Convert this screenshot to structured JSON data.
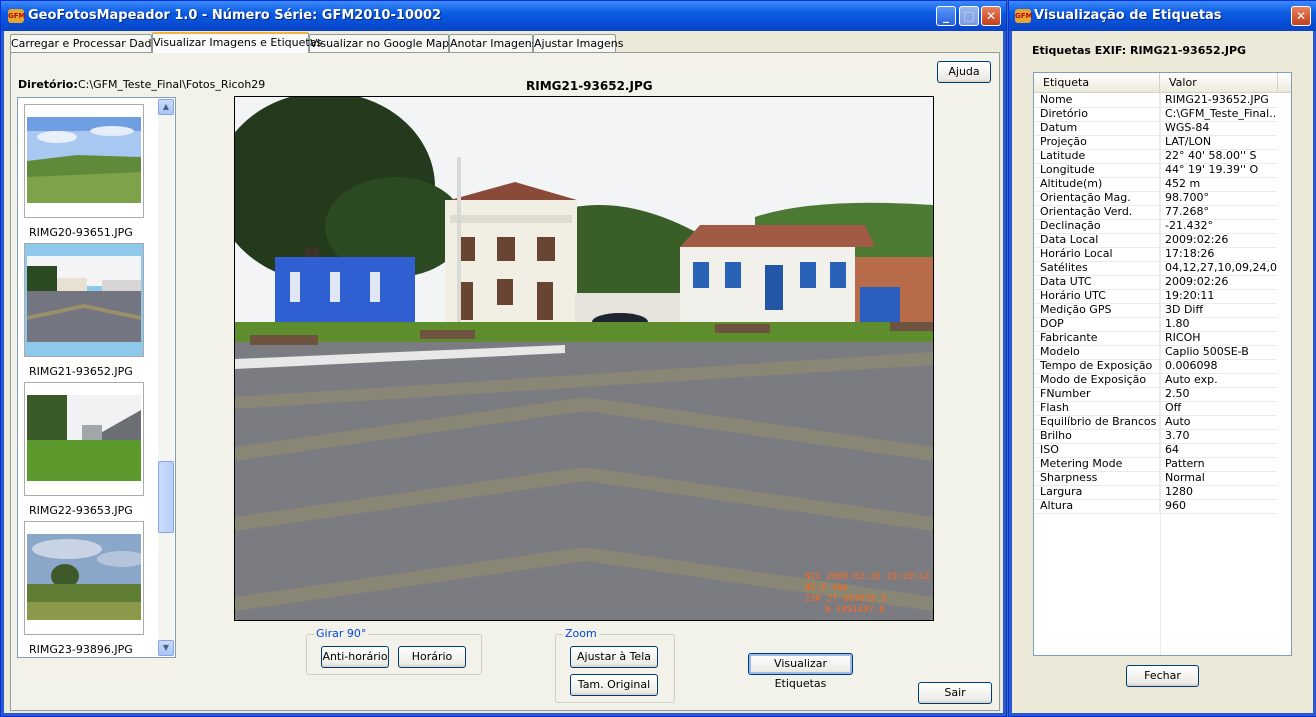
{
  "main_window": {
    "title": "GeoFotosMapeador 1.0 - Número Série: GFM2010-10002",
    "icon_text": "GFM",
    "tabs": [
      {
        "label": "Carregar e Processar Dados"
      },
      {
        "label": "Visualizar Imagens e Etiquetas"
      },
      {
        "label": "Visualizar no Google Maps"
      },
      {
        "label": "Anotar Imagens"
      },
      {
        "label": "Ajustar Imagens"
      }
    ],
    "active_tab": "Visualizar Imagens e Etiquetas",
    "help_button": "Ajuda",
    "directory_label": "Diretório:",
    "directory_value": "C:\\GFM_Teste_Final\\Fotos_Ricoh29",
    "image_title": "RIMG21-93652.JPG",
    "thumbnails": [
      {
        "caption": "RIMG20-93651.JPG",
        "selected": false
      },
      {
        "caption": "RIMG21-93652.JPG",
        "selected": true
      },
      {
        "caption": "RIMG22-93653.JPG",
        "selected": false
      },
      {
        "caption": "RIMG23-93896.JPG",
        "selected": false
      }
    ],
    "photo_overlay": [
      "NIC 2009:02:26 19:20:14",
      "N3:E 4mm",
      "23K 2T 663639.5",
      "N 2491497.0"
    ],
    "rotate_group": {
      "title": "Girar 90°",
      "ccw_button": "Anti-horário",
      "cw_button": "Horário"
    },
    "zoom_group": {
      "title": "Zoom",
      "fit_button": "Ajustar à Tela",
      "original_button": "Tam. Original"
    },
    "view_tags_button": "Visualizar Etiquetas",
    "exit_button": "Sair"
  },
  "tags_window": {
    "title": "Visualização de Etiquetas",
    "icon_text": "GFM",
    "heading": "Etiquetas EXIF: RIMG21-93652.JPG",
    "columns": {
      "key": "Etiqueta",
      "value": "Valor"
    },
    "rows": [
      {
        "k": "Nome",
        "v": "RIMG21-93652.JPG"
      },
      {
        "k": "Diretório",
        "v": "C:\\GFM_Teste_Final..."
      },
      {
        "k": "Datum",
        "v": "WGS-84"
      },
      {
        "k": "Projeção",
        "v": "LAT/LON"
      },
      {
        "k": "Latitude",
        "v": "22° 40' 58.00'' S"
      },
      {
        "k": "Longitude",
        "v": "44° 19' 19.39'' O"
      },
      {
        "k": "Altitude(m)",
        "v": "452 m"
      },
      {
        "k": "Orientação Mag.",
        "v": "98.700°"
      },
      {
        "k": "Orientação Verd.",
        "v": "77.268°"
      },
      {
        "k": "Declinação",
        "v": "-21.432°"
      },
      {
        "k": "Data Local",
        "v": "2009:02:26"
      },
      {
        "k": "Horário Local",
        "v": "17:18:26"
      },
      {
        "k": "Satélites",
        "v": "04,12,27,10,09,24,0..."
      },
      {
        "k": "Data UTC",
        "v": "2009:02:26"
      },
      {
        "k": "Horário UTC",
        "v": "19:20:11"
      },
      {
        "k": "Medição GPS",
        "v": "3D Diff"
      },
      {
        "k": "DOP",
        "v": "1.80"
      },
      {
        "k": "Fabricante",
        "v": "RICOH"
      },
      {
        "k": "Modelo",
        "v": "Caplio 500SE-B"
      },
      {
        "k": "Tempo de Exposição",
        "v": "0.006098"
      },
      {
        "k": "Modo de Exposição",
        "v": "Auto exp."
      },
      {
        "k": "FNumber",
        "v": "2.50"
      },
      {
        "k": "Flash",
        "v": "Off"
      },
      {
        "k": "Equilíbrio de Brancos",
        "v": "Auto"
      },
      {
        "k": "Brilho",
        "v": "3.70"
      },
      {
        "k": "ISO",
        "v": "64"
      },
      {
        "k": "Metering Mode",
        "v": "Pattern"
      },
      {
        "k": "Sharpness",
        "v": "Normal"
      },
      {
        "k": "Largura",
        "v": "1280"
      },
      {
        "k": "Altura",
        "v": "960"
      }
    ],
    "close_button": "Fechar"
  },
  "colors": {
    "titlebar": "#0a5be3",
    "group_title": "#0046d5",
    "selection": "#8ec9ec",
    "overlay_text": "#ff6a1a"
  }
}
